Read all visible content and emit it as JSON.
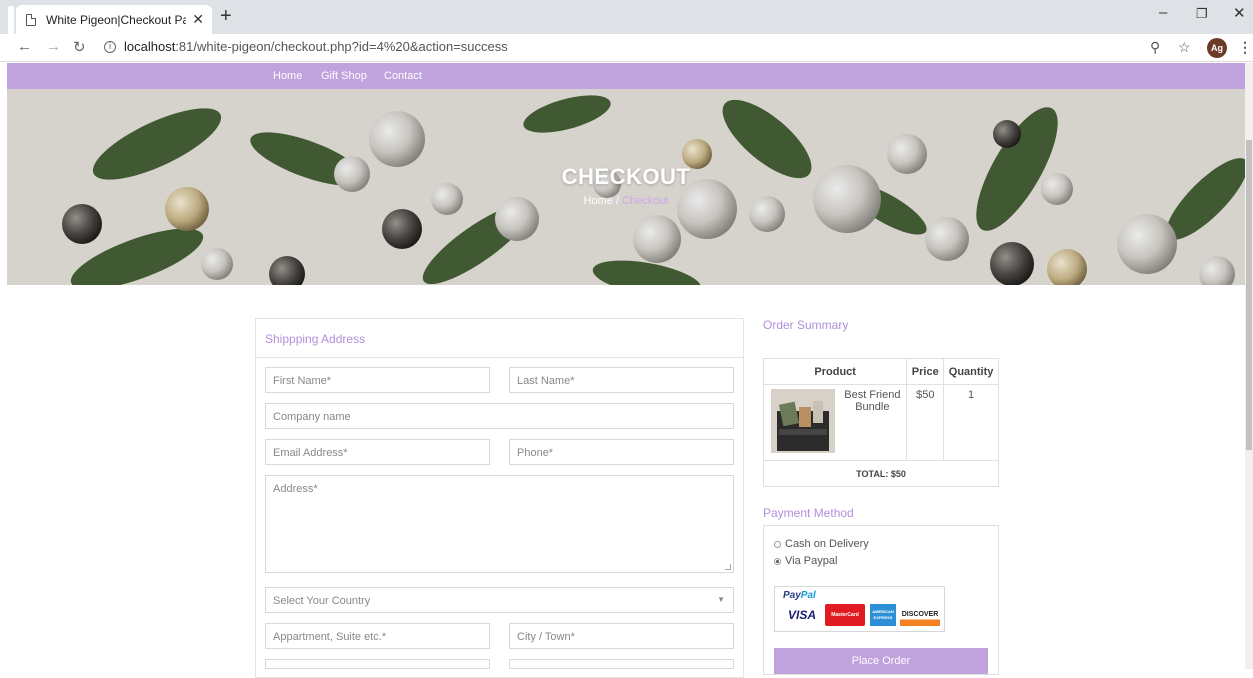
{
  "browser": {
    "tab_title": "White Pigeon|Checkout Page",
    "url_host": "localhost",
    "url_path": ":81/white-pigeon/checkout.php?id=4%20&action=success",
    "avatar_initials": "Ag"
  },
  "nav": {
    "items": [
      "Home",
      "Gift Shop",
      "Contact"
    ]
  },
  "hero": {
    "title": "CHECKOUT",
    "breadcrumb_home": "Home",
    "breadcrumb_sep": "/",
    "breadcrumb_current": "Checkout"
  },
  "shipping": {
    "title": "Shippping Address",
    "first_name": "First Name*",
    "last_name": "Last Name*",
    "company": "Company name",
    "email": "Email Address*",
    "phone": "Phone*",
    "address": "Address*",
    "country": "Select Your Country",
    "apartment": "Appartment, Suite etc.*",
    "city": "City / Town*"
  },
  "summary": {
    "title": "Order Summary",
    "col_product": "Product",
    "col_price": "Price",
    "col_quantity": "Quantity",
    "item_name": "Best Friend Bundle",
    "item_price": "$50",
    "item_quantity": "1",
    "total": "TOTAL: $50"
  },
  "payment": {
    "title": "Payment Method",
    "option_cod": "Cash on Delivery",
    "option_paypal": "Via Paypal",
    "selected": "Via Paypal",
    "paypal_logo_a": "Pay",
    "paypal_logo_b": "Pal",
    "card_visa": "VISA",
    "card_mc": "MasterCard",
    "card_amex": "AMERICAN EXPRESS",
    "card_discover": "DISCOVER",
    "place_order": "Place Order"
  },
  "colors": {
    "accent": "#c0a2dc",
    "accent_text": "#b18fdb"
  }
}
